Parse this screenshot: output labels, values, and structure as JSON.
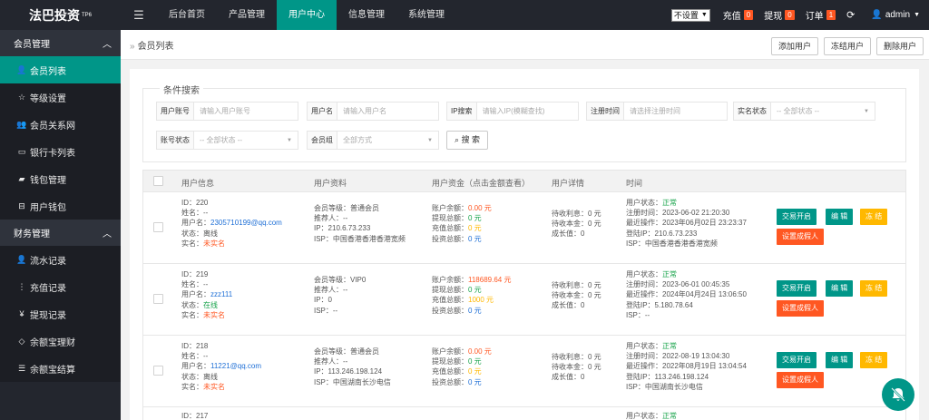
{
  "topbar": {
    "logo": "法巴投资",
    "logo_sup": "TP6",
    "nav": [
      "后台首页",
      "产品管理",
      "用户中心",
      "信息管理",
      "系统管理"
    ],
    "active_nav": 2,
    "select_value": "不设置",
    "withdraw_a": {
      "label": "充值",
      "count": "0"
    },
    "withdraw_b": {
      "label": "提现",
      "count": "0"
    },
    "orders": {
      "label": "订单",
      "count": "1"
    },
    "user": "admin"
  },
  "sidebar": {
    "group1": "会员管理",
    "items1": [
      "会员列表",
      "等级设置",
      "会员关系网",
      "银行卡列表",
      "钱包管理",
      "用户钱包"
    ],
    "group2": "财务管理",
    "items2": [
      "流水记录",
      "充值记录",
      "提现记录",
      "余额宝理财",
      "余额宝结算"
    ]
  },
  "header": {
    "breadcrumb": "会员列表",
    "buttons": [
      "添加用户",
      "冻结用户",
      "删除用户"
    ]
  },
  "search": {
    "legend": "条件搜索",
    "account_label": "用户账号",
    "account_ph": "请输入用户账号",
    "name_label": "用户名",
    "name_ph": "请输入用户名",
    "ip_label": "IP搜索",
    "ip_ph": "请输入IP(模糊查找)",
    "reg_label": "注册时间",
    "reg_ph": "请选择注册时间",
    "real_label": "实名状态",
    "real_value": "-- 全部状态 --",
    "acct_status_label": "账号状态",
    "acct_status_value": "-- 全部状态 --",
    "group_label": "会员组",
    "group_value": "全部方式",
    "search_btn": "搜 索"
  },
  "table": {
    "headers": [
      "用户信息",
      "用户资料",
      "用户资金（点击金额查看）",
      "用户详情",
      "时间"
    ],
    "rows": [
      {
        "id": "ID：220",
        "realname": "姓名：--",
        "username_label": "用户名：",
        "username": "2305710199@qq.com",
        "status_label": "状态：",
        "status": "离线",
        "auth_label": "实名：",
        "auth": "未实名",
        "level": "会员等级：普通会员",
        "referrer": "推荐人：--",
        "ip": "IP：210.6.73.233",
        "isp": "ISP：中国香港香港香港宽频",
        "balance_label": "账户余额：",
        "balance": "0.00 元",
        "withdraw_label": "提现总额：",
        "withdraw": "0 元",
        "recharge_label": "充值总额：",
        "recharge": "0 元",
        "invest_label": "投资总额：",
        "invest": "0 元",
        "pending_interest": "待收利息：0 元",
        "pending_principal": "待收本金：0 元",
        "growth": "成长值：0",
        "ustatus_label": "用户状态：",
        "ustatus": "正常",
        "reg_time": "注册时间：2023-06-02 21:20:30",
        "last_op": "最近操作：2023年06月02日 23:23:37",
        "login_ip": "登陆IP：210.6.73.233",
        "tisp": "ISP：中国香港香港香港宽频"
      },
      {
        "id": "ID：219",
        "realname": "姓名：--",
        "username_label": "用户名：",
        "username": "zzz111",
        "status_label": "状态：",
        "status": "在线",
        "auth_label": "实名：",
        "auth": "未实名",
        "level": "会员等级：VIP0",
        "referrer": "推荐人：--",
        "ip": "IP：0",
        "isp": "ISP：--",
        "balance_label": "账户余额：",
        "balance": "118689.64 元",
        "withdraw_label": "提现总额：",
        "withdraw": "0 元",
        "recharge_label": "充值总额：",
        "recharge": "1000 元",
        "invest_label": "投资总额：",
        "invest": "0 元",
        "pending_interest": "待收利息：0 元",
        "pending_principal": "待收本金：0 元",
        "growth": "成长值：0",
        "ustatus_label": "用户状态：",
        "ustatus": "正常",
        "reg_time": "注册时间：2023-06-01 00:45:35",
        "last_op": "最近操作：2024年04月24日 13:06:50",
        "login_ip": "登陆IP：5.180.78.64",
        "tisp": "ISP：--"
      },
      {
        "id": "ID：218",
        "realname": "姓名：--",
        "username_label": "用户名：",
        "username": "11221@qq.com",
        "status_label": "状态：",
        "status": "离线",
        "auth_label": "实名：",
        "auth": "未实名",
        "level": "会员等级：普通会员",
        "referrer": "推荐人：--",
        "ip": "IP：113.246.198.124",
        "isp": "ISP：中国湖南长沙电信",
        "balance_label": "账户余额：",
        "balance": "0.00 元",
        "withdraw_label": "提现总额：",
        "withdraw": "0 元",
        "recharge_label": "充值总额：",
        "recharge": "0 元",
        "invest_label": "投资总额：",
        "invest": "0 元",
        "pending_interest": "待收利息：0 元",
        "pending_principal": "待收本金：0 元",
        "growth": "成长值：0",
        "ustatus_label": "用户状态：",
        "ustatus": "正常",
        "reg_time": "注册时间：2022-08-19 13:04:30",
        "last_op": "最近操作：2022年08月19日 13:04:54",
        "login_ip": "登陆IP：113.246.198.124",
        "tisp": "ISP：中国湖南长沙电信"
      }
    ],
    "partial_id": "ID：217",
    "partial_status_label": "用户状态：",
    "partial_status": "正常",
    "actions": [
      "交易开启",
      "编 辑",
      "冻 结",
      "设置成假人"
    ]
  },
  "colors": {
    "accent": "#009688",
    "danger": "#ff5722",
    "warn": "#ffb800",
    "dark": "#23262e"
  }
}
